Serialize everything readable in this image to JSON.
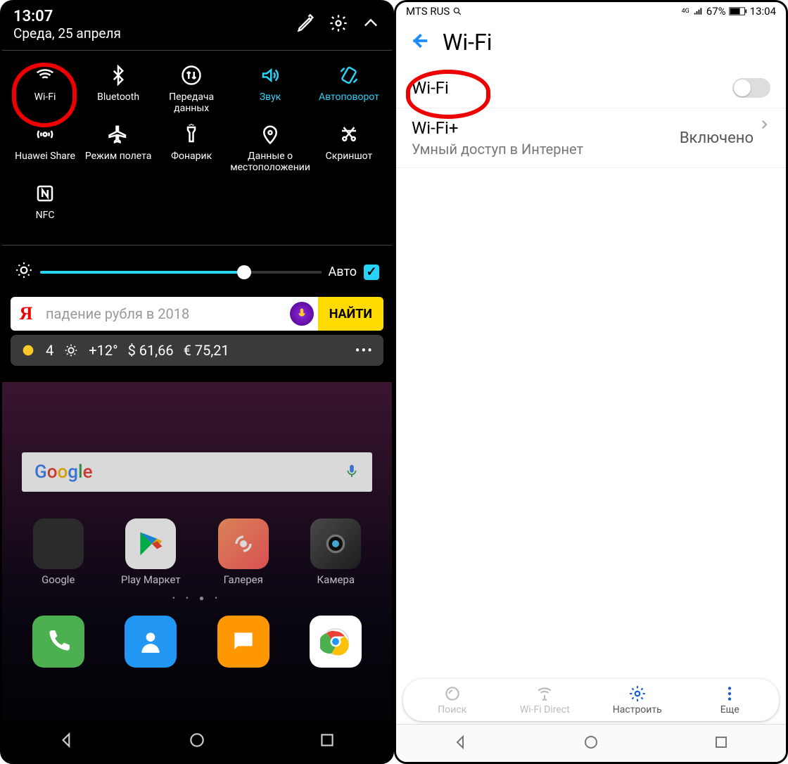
{
  "left": {
    "status": {
      "time": "13:07",
      "date": "Среда, 25 апреля"
    },
    "qs": {
      "wifi": "Wi-Fi",
      "bluetooth": "Bluetooth",
      "data": "Передача данных",
      "sound": "Звук",
      "autorotate": "Автоповорот",
      "huaweishare": "Huawei Share",
      "airplane": "Режим полета",
      "flash": "Фонарик",
      "location": "Данные о местоположении",
      "screenshot": "Скриншот",
      "nfc": "NFC"
    },
    "brightness": {
      "auto": "Авто"
    },
    "search": {
      "placeholder": "падение рубля в 2018",
      "button": "НАЙТИ"
    },
    "weather": {
      "moon_temp": "4",
      "sun_temp": "+12°",
      "usd": "$ 61,66",
      "eur": "€ 75,21"
    },
    "apps": {
      "google": "Google",
      "play": "Play Маркет",
      "gallery": "Галерея",
      "camera": "Камера"
    }
  },
  "right": {
    "status": {
      "carrier": "MTS RUS",
      "battery": "67%",
      "time": "13:04",
      "net": "4G"
    },
    "header": "Wi-Fi",
    "row_wifi": "Wi-Fi",
    "row_wifiplus": {
      "title": "Wi-Fi+",
      "sub": "Умный доступ в Интернет",
      "value": "Включено"
    },
    "bottom": {
      "search": "Поиск",
      "direct": "Wi-Fi Direct",
      "config": "Настроить",
      "more": "Еще"
    }
  }
}
